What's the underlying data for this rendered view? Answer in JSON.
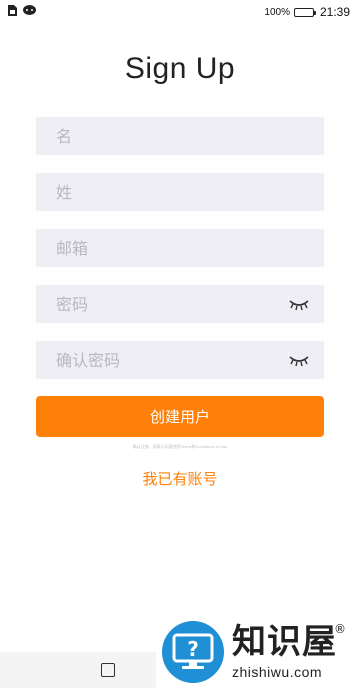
{
  "status_bar": {
    "battery_percent": "100%",
    "time": "21:39"
  },
  "title": "Sign Up",
  "form": {
    "first_name_placeholder": "名",
    "last_name_placeholder": "姓",
    "email_placeholder": "邮箱",
    "password_placeholder": "密码",
    "confirm_password_placeholder": "确认密码",
    "submit_label": "创建用户",
    "fineprint": "确认注册，即表示同意使用Terms和Conditions of Use",
    "login_link": "我已有账号"
  },
  "watermark": {
    "brand_cn": "知识屋",
    "brand_en": "zhishiwu.com",
    "registered_mark": "®",
    "logo_mark": "?"
  },
  "icons": {
    "status_left": [
      "sim-icon",
      "chat-icon"
    ],
    "password_toggle": "eye-closed-icon",
    "nav": [
      "recent-apps-icon",
      "home-icon",
      "back-icon"
    ]
  },
  "colors": {
    "accent": "#ff8008",
    "field_bg": "#eeeef4",
    "watermark_blue": "#1f8fd6"
  }
}
